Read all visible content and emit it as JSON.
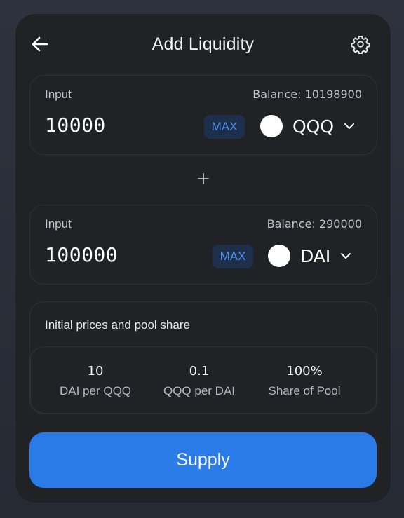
{
  "header": {
    "title": "Add Liquidity",
    "back_icon": "arrow-left-icon",
    "settings_icon": "gear-icon"
  },
  "inputs": [
    {
      "label": "Input",
      "balance": "Balance: 10198900",
      "amount": "10000",
      "max_label": "MAX",
      "token": "QQQ"
    },
    {
      "label": "Input",
      "balance": "Balance: 290000",
      "amount": "100000",
      "max_label": "MAX",
      "token": "DAI"
    }
  ],
  "plus_icon": "plus-icon",
  "prices": {
    "title": "Initial prices and pool share",
    "stats": [
      {
        "value": "10",
        "label": "DAI per QQQ"
      },
      {
        "value": "0.1",
        "label": "QQQ per DAI"
      },
      {
        "value": "100%",
        "label": "Share of Pool"
      }
    ]
  },
  "supply_label": "Supply",
  "colors": {
    "accent": "#2a7ae8",
    "max_text": "#4d8fea",
    "card_bg": "#212226"
  }
}
